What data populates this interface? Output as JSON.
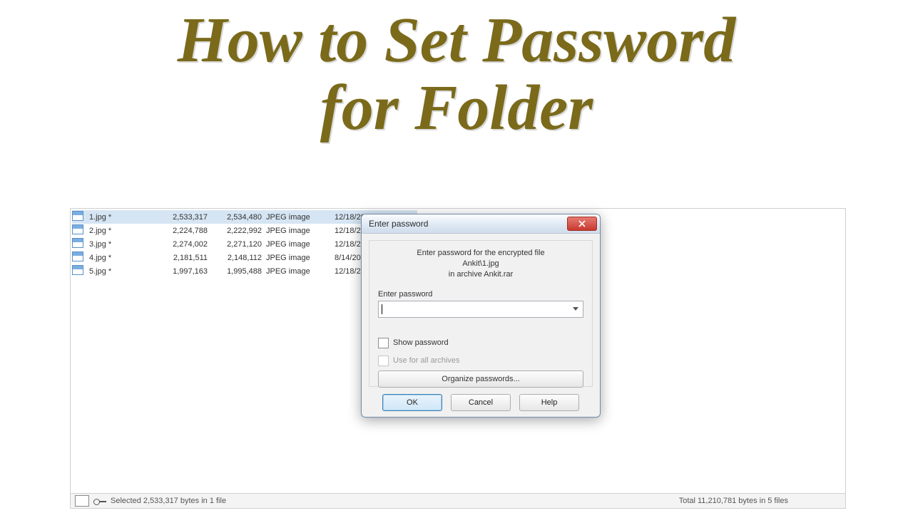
{
  "title": {
    "line1": "How to Set Password",
    "line2": "for Folder"
  },
  "files": [
    {
      "name": "1.jpg *",
      "size": "2,533,317",
      "packed": "2,534,480",
      "type": "JPEG image",
      "date": "12/18/2017 6:1…",
      "selected": true
    },
    {
      "name": "2.jpg *",
      "size": "2,224,788",
      "packed": "2,222,992",
      "type": "JPEG image",
      "date": "12/18/2017 6:1…",
      "selected": false
    },
    {
      "name": "3.jpg *",
      "size": "2,274,002",
      "packed": "2,271,120",
      "type": "JPEG image",
      "date": "12/18/2017 6:1…",
      "selected": false
    },
    {
      "name": "4.jpg *",
      "size": "2,181,511",
      "packed": "2,148,112",
      "type": "JPEG image",
      "date": "8/14/2018 4:31 …",
      "selected": false
    },
    {
      "name": "5.jpg *",
      "size": "1,997,163",
      "packed": "1,995,488",
      "type": "JPEG image",
      "date": "12/18/2017 6:1…",
      "selected": false
    }
  ],
  "statusbar": {
    "left": "Selected 2,533,317 bytes in 1 file",
    "right": "Total 11,210,781 bytes in 5 files"
  },
  "dialog": {
    "title": "Enter password",
    "msg1": "Enter password for the encrypted file",
    "msg2": "Ankit\\1.jpg",
    "msg3": "in archive Ankit.rar",
    "field_label": "Enter password",
    "show_password": "Show password",
    "use_for_all": "Use for all archives",
    "organize": "Organize passwords...",
    "ok": "OK",
    "cancel": "Cancel",
    "help": "Help"
  }
}
